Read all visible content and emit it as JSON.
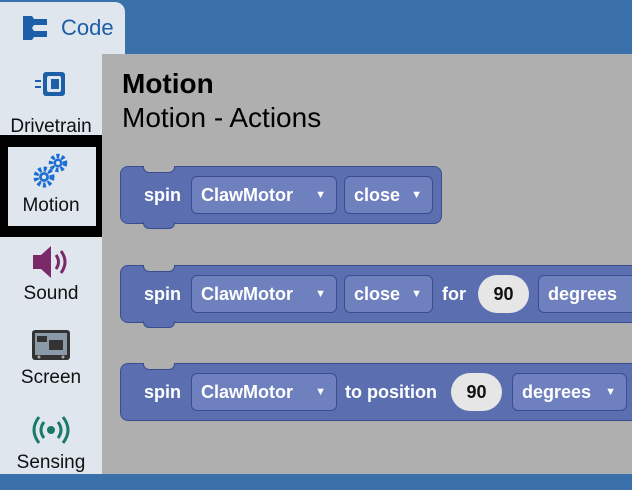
{
  "tab": {
    "label": "Code",
    "icon": "code-blocks-icon"
  },
  "sidebar": {
    "items": [
      {
        "label": "Drivetrain",
        "icon": "drivetrain-icon",
        "color": "#1d5ea8"
      },
      {
        "label": "Motion",
        "icon": "gears-icon",
        "color": "#1d6fd1",
        "selected": true
      },
      {
        "label": "Sound",
        "icon": "speaker-icon",
        "color": "#7a2a69"
      },
      {
        "label": "Screen",
        "icon": "screen-icon",
        "color": "#333333"
      },
      {
        "label": "Sensing",
        "icon": "signal-icon",
        "color": "#1a7a6a"
      }
    ]
  },
  "workspace": {
    "title": "Motion",
    "subtitle": "Motion - Actions",
    "blocks": [
      {
        "spin": "spin",
        "motor": "ClawMotor",
        "direction": "close"
      },
      {
        "spin": "spin",
        "motor": "ClawMotor",
        "direction": "close",
        "for": "for",
        "amount": "90",
        "unit": "degrees"
      },
      {
        "spin": "spin",
        "motor": "ClawMotor",
        "to_position": "to position",
        "amount": "90",
        "unit": "degrees"
      }
    ]
  },
  "colors": {
    "header": "#3a71ab",
    "sidebar": "#dfe6ee",
    "workspace": "#afafaf",
    "block": "#5b6fb0"
  }
}
